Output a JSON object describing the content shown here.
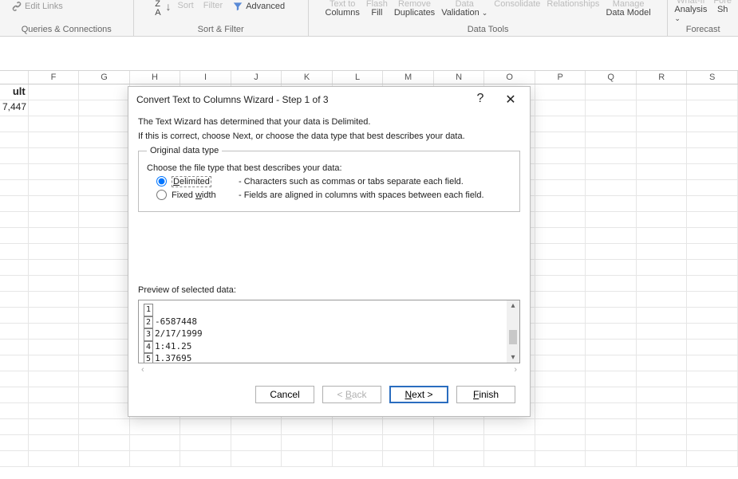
{
  "ribbon": {
    "edit_links": "Edit Links",
    "group_connections": "Queries & Connections",
    "sort": "Sort",
    "filter": "Filter",
    "advanced": "Advanced",
    "za": "Z",
    "az": "A",
    "group_sortfilter": "Sort & Filter",
    "text_to": "Text to",
    "columns": "Columns",
    "flash": "Flash",
    "fill": "Fill",
    "remove": "Remove",
    "duplicates": "Duplicates",
    "data": "Data",
    "validation": "Validation",
    "consolidate": "Consolidate",
    "relationships": "Relationships",
    "manage": "Manage",
    "datamodel": "Data Model",
    "group_datatools": "Data Tools",
    "whatif": "What-If",
    "analysis": "Analysis",
    "fore": "Fore",
    "sh": "Sh",
    "group_forecast": "Forecast"
  },
  "grid": {
    "columns": [
      "F",
      "G",
      "H",
      "I",
      "J",
      "K",
      "L",
      "M",
      "N",
      "O",
      "P",
      "Q",
      "R",
      "S"
    ],
    "a1_label": "ult",
    "a2_value": "7,447"
  },
  "dialog": {
    "title": "Convert Text to Columns Wizard - Step 1 of 3",
    "help": "?",
    "close": "✕",
    "line1": "The Text Wizard has determined that your data is Delimited.",
    "line2": "If this is correct, choose Next, or choose the data type that best describes your data.",
    "legend": "Original data type",
    "choose": "Choose the file type that best describes your data:",
    "delimited_pre": "D",
    "delimited_rest": "elimited",
    "delimited_desc": "- Characters such as commas or tabs separate each field.",
    "fixed_pre": "Fixed ",
    "fixed_u": "w",
    "fixed_post": "idth",
    "fixed_desc": "- Fields are aligned in columns with spaces between each field.",
    "preview_label": "Preview of selected data:",
    "preview_lines": [
      {
        "n": "1",
        "t": ""
      },
      {
        "n": "2",
        "t": "-6587448"
      },
      {
        "n": "3",
        "t": "2/17/1999"
      },
      {
        "n": "4",
        "t": "1:41.25"
      },
      {
        "n": "5",
        "t": "1.37695"
      }
    ],
    "btn_cancel": "Cancel",
    "btn_back": "< Back",
    "btn_next": "Next >",
    "btn_finish": "Finish",
    "next_u": "N",
    "next_rest": "ext >",
    "finish_u": "F",
    "finish_rest": "inish",
    "back_pre": "< ",
    "back_u": "B",
    "back_rest": "ack"
  }
}
